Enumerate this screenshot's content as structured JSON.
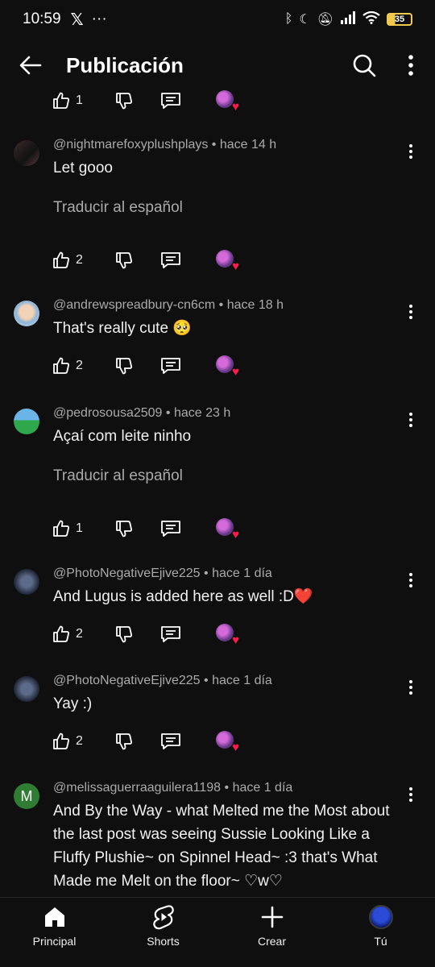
{
  "status": {
    "time": "10:59",
    "battery": "35"
  },
  "header": {
    "title": "Publicación"
  },
  "top_actions": {
    "likes": "1"
  },
  "comments": [
    {
      "author": "@nightmarefoxyplushplays",
      "age": "hace 14 h",
      "text": "Let gooo",
      "translate": "Traducir al español",
      "likes": "2"
    },
    {
      "author": "@andrewspreadbury-cn6cm",
      "age": "hace 18 h",
      "text": "That's really cute 🥺",
      "likes": "2"
    },
    {
      "author": "@pedrosousa2509",
      "age": "hace 23 h",
      "text": "Açaí com leite ninho",
      "translate": "Traducir al español",
      "likes": "1"
    },
    {
      "author": "@PhotoNegativeEjive225",
      "age": "hace 1 día",
      "text": "And Lugus is added here as well :D❤️",
      "likes": "2"
    },
    {
      "author": "@PhotoNegativeEjive225",
      "age": "hace 1 día",
      "text": "Yay :)",
      "likes": "2"
    },
    {
      "author": "@melissaguerraaguilera1198",
      "age": "hace 1 día",
      "avatar_letter": "M",
      "text": "And By the Way - what Melted me the Most about the last post was seeing Sussie Looking Like a Fluffy Plushie~ on Spinnel Head~ :3 that's What Made me Melt on the floor~ ♡w♡"
    }
  ],
  "nav": {
    "home": "Principal",
    "shorts": "Shorts",
    "create": "Crear",
    "you": "Tú"
  },
  "icons": {
    "back": "arrow-left-icon",
    "search": "search-icon",
    "menu": "more-vert-icon",
    "like": "thumb-up-icon",
    "dislike": "thumb-down-icon",
    "reply": "comment-icon"
  }
}
